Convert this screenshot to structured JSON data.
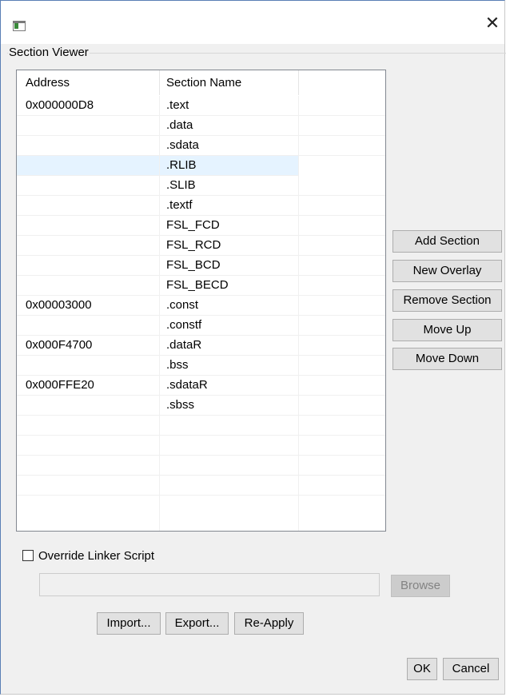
{
  "window": {
    "title": "",
    "close_glyph": "✕"
  },
  "section_viewer": {
    "group_title": "Section Viewer",
    "columns": [
      "Address",
      "Section Name",
      ""
    ],
    "rows": [
      {
        "address": "0x000000D8",
        "name": ".text"
      },
      {
        "address": "",
        "name": ".data"
      },
      {
        "address": "",
        "name": ".sdata"
      },
      {
        "address": "",
        "name": ".RLIB",
        "selected": true
      },
      {
        "address": "",
        "name": ".SLIB"
      },
      {
        "address": "",
        "name": ".textf"
      },
      {
        "address": "",
        "name": "FSL_FCD"
      },
      {
        "address": "",
        "name": "FSL_RCD"
      },
      {
        "address": "",
        "name": "FSL_BCD"
      },
      {
        "address": "",
        "name": "FSL_BECD"
      },
      {
        "address": "0x00003000",
        "name": ".const"
      },
      {
        "address": "",
        "name": ".constf"
      },
      {
        "address": "0x000F4700",
        "name": ".dataR"
      },
      {
        "address": "",
        "name": ".bss"
      },
      {
        "address": "0x000FFE20",
        "name": ".sdataR"
      },
      {
        "address": "",
        "name": ".sbss"
      },
      {
        "address": "",
        "name": ""
      },
      {
        "address": "",
        "name": ""
      },
      {
        "address": "",
        "name": ""
      },
      {
        "address": "",
        "name": ""
      }
    ]
  },
  "side_buttons": {
    "add_section": "Add Section",
    "new_overlay": "New Overlay",
    "remove_section": "Remove Section",
    "move_up": "Move Up",
    "move_down": "Move Down"
  },
  "override": {
    "checkbox_label": "Override Linker Script",
    "checked": false,
    "path_value": "",
    "browse_label": "Browse"
  },
  "bottom_buttons": {
    "import": "Import...",
    "export": "Export...",
    "reapply": "Re-Apply",
    "ok": "OK",
    "cancel": "Cancel"
  },
  "colors": {
    "selected_row": "#e5f3ff",
    "window_border": "#5a7fb5",
    "button_face": "#e1e1e1"
  }
}
